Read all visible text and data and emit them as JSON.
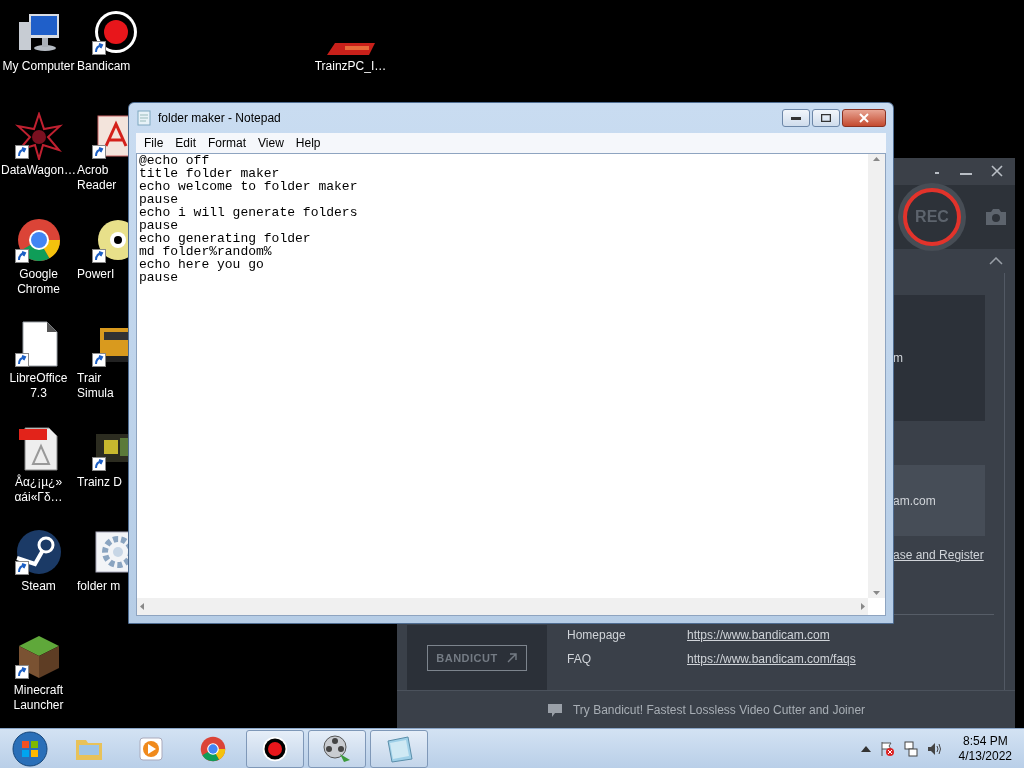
{
  "desktop": {
    "columns": [
      [
        {
          "kind": "computer",
          "lines": [
            "My Computer"
          ],
          "shortcut": false
        },
        {
          "kind": "star",
          "lines": [
            "DataWagon…"
          ],
          "shortcut": true
        },
        {
          "kind": "browser",
          "lines": [
            "Google",
            "Chrome"
          ],
          "shortcut": true
        },
        {
          "kind": "document",
          "lines": [
            "LibreOffice",
            "7.3"
          ],
          "shortcut": true
        },
        {
          "kind": "pdf",
          "lines": [
            "Åα¿¡µ¿»",
            "αái«Γδ…"
          ],
          "shortcut": false
        },
        {
          "kind": "steam",
          "lines": [
            "Steam"
          ],
          "shortcut": true
        },
        {
          "kind": "cube",
          "lines": [
            "Minecraft",
            "Launcher"
          ],
          "shortcut": true
        }
      ],
      [
        {
          "kind": "record",
          "lines": [
            "Bandicam"
          ],
          "shortcut": true
        },
        {
          "kind": "acrobat",
          "lines": [
            "Acrob",
            "Reader"
          ],
          "shortcut": true
        },
        {
          "kind": "disc",
          "lines": [
            "PowerI"
          ],
          "shortcut": true
        },
        {
          "kind": "train",
          "lines": [
            "Trair",
            "Simula"
          ],
          "shortcut": true
        },
        {
          "kind": "photo",
          "lines": [
            "Trainz D"
          ],
          "shortcut": true
        },
        {
          "kind": "gear",
          "lines": [
            "folder m"
          ],
          "shortcut": false
        }
      ]
    ],
    "free_icons": [
      {
        "kind": "logo",
        "lines": [
          "TrainzPC_I…"
        ],
        "shortcut": false
      }
    ]
  },
  "notepad": {
    "title": "folder maker - Notepad",
    "menu": [
      "File",
      "Edit",
      "Format",
      "View",
      "Help"
    ],
    "lines": [
      "@echo off",
      "title folder maker",
      "echo welcome to folder maker",
      "pause",
      "echo i will generate folders",
      "pause",
      "echo generating folder",
      "md folder%random%",
      "echo here you go",
      "pause"
    ]
  },
  "recorder": {
    "rec": "REC",
    "card_text": "m",
    "site_text": "am.com",
    "register_link": "ase and Register",
    "links": [
      {
        "label": "Homepage",
        "url": "https://www.bandicam.com"
      },
      {
        "label": "FAQ",
        "url": "https://www.bandicam.com/faqs"
      }
    ],
    "bandicut_button": "BANDICUT",
    "footer": "Try Bandicut! Fastest Lossless Video Cutter and Joiner"
  },
  "taskbar": {
    "items": [
      {
        "kind": "folder",
        "open": false
      },
      {
        "kind": "media",
        "open": false
      },
      {
        "kind": "browser",
        "open": false
      },
      {
        "kind": "record",
        "open": true
      },
      {
        "kind": "film",
        "open": true
      },
      {
        "kind": "notepad",
        "open": true
      }
    ],
    "time": "8:54 PM",
    "date": "4/13/2022"
  }
}
